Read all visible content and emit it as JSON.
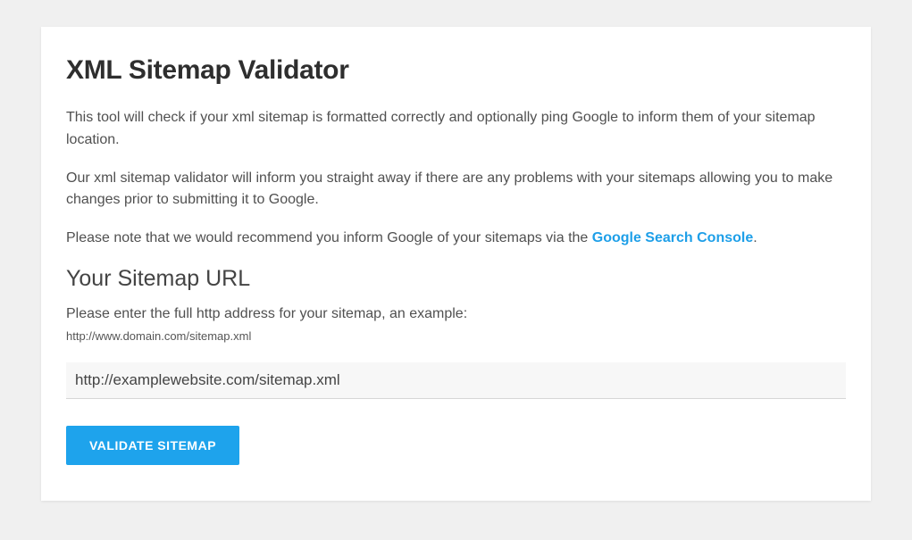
{
  "title": "XML Sitemap Validator",
  "paragraphs": {
    "p1": "This tool will check if your xml sitemap is formatted correctly and optionally ping Google to inform them of your sitemap location.",
    "p2": "Our xml sitemap validator will inform you straight away if there are any problems with your sitemaps allowing you to make changes prior to submitting it to Google.",
    "p3_prefix": "Please note that we would recommend you inform Google of your sitemaps via the ",
    "p3_link": "Google Search Console",
    "p3_suffix": "."
  },
  "section_heading": "Your Sitemap URL",
  "instruction": "Please enter the full http address for your sitemap, an example:",
  "example_url": "http://www.domain.com/sitemap.xml",
  "input": {
    "value": "http://examplewebsite.com/sitemap.xml",
    "placeholder": ""
  },
  "button_label": "VALIDATE SITEMAP"
}
